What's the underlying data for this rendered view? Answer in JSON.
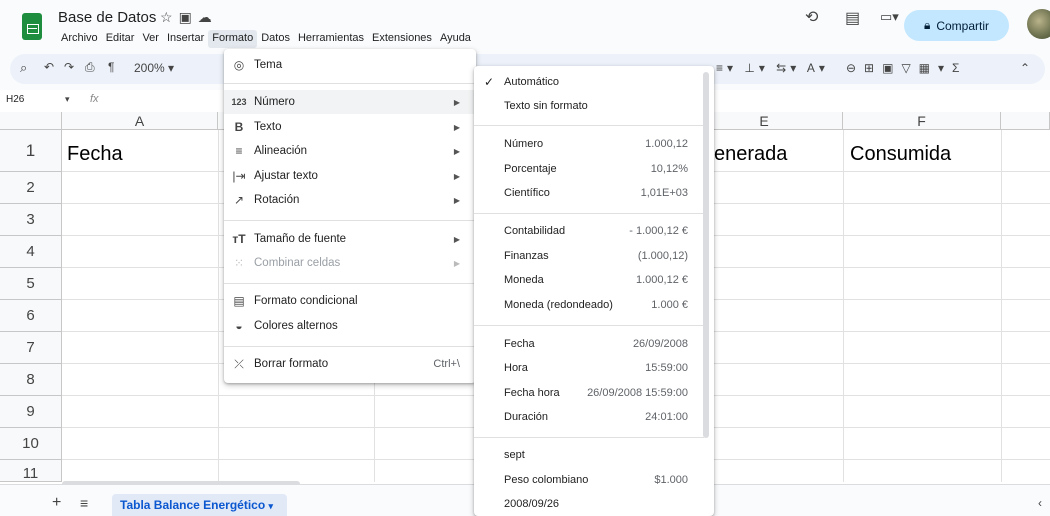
{
  "header": {
    "doc_title": "Base de Datos",
    "share_label": "Compartir"
  },
  "menubar": [
    "Archivo",
    "Editar",
    "Ver",
    "Insertar",
    "Formato",
    "Datos",
    "Herramientas",
    "Extensiones",
    "Ayuda"
  ],
  "toolbar": {
    "zoom": "200%"
  },
  "formula_bar": {
    "cell_ref": "H26",
    "fx": "fx"
  },
  "grid": {
    "columns": [
      "A",
      "E",
      "F"
    ],
    "rows": [
      "1",
      "2",
      "3",
      "4",
      "5",
      "6",
      "7",
      "8",
      "9",
      "10",
      "11"
    ],
    "cells": {
      "a1": "Fecha",
      "e1": "enerada",
      "f1": "Consumida"
    }
  },
  "sheets": {
    "active_tab": "Tabla Balance Energético"
  },
  "formato_menu": {
    "items": [
      {
        "icon": "palette-icon",
        "label": "Tema"
      },
      {
        "icon": "number-icon",
        "label": "Número",
        "glyph": "123"
      },
      {
        "icon": "bold-icon",
        "label": "Texto"
      },
      {
        "icon": "align-icon",
        "label": "Alineación"
      },
      {
        "icon": "wrap-icon",
        "label": "Ajustar texto"
      },
      {
        "icon": "rotate-icon",
        "label": "Rotación"
      },
      {
        "icon": "font-size-icon",
        "label": "Tamaño de fuente"
      },
      {
        "icon": "merge-icon",
        "label": "Combinar celdas"
      },
      {
        "icon": "conditional-icon",
        "label": "Formato condicional"
      },
      {
        "icon": "alternate-colors-icon",
        "label": "Colores alternos"
      },
      {
        "icon": "clear-format-icon",
        "label": "Borrar formato",
        "shortcut": "Ctrl+\\"
      }
    ]
  },
  "numero_menu": {
    "automatico": "Automático",
    "texto_sin_formato": "Texto sin formato",
    "numero": {
      "label": "Número",
      "value": "1.000,12"
    },
    "porcentaje": {
      "label": "Porcentaje",
      "value": "10,12%"
    },
    "cientifico": {
      "label": "Científico",
      "value": "1,01E+03"
    },
    "contabilidad": {
      "label": "Contabilidad",
      "value": "- 1.000,12 €"
    },
    "finanzas": {
      "label": "Finanzas",
      "value": "(1.000,12)"
    },
    "moneda": {
      "label": "Moneda",
      "value": "1.000,12 €"
    },
    "moneda_red": {
      "label": "Moneda (redondeado)",
      "value": "1.000 €"
    },
    "fecha": {
      "label": "Fecha",
      "value": "26/09/2008"
    },
    "hora": {
      "label": "Hora",
      "value": "15:59:00"
    },
    "fecha_hora": {
      "label": "Fecha hora",
      "value": "26/09/2008 15:59:00"
    },
    "duracion": {
      "label": "Duración",
      "value": "24:01:00"
    },
    "sept": "sept",
    "peso": {
      "label": "Peso colombiano",
      "value": "$1.000"
    },
    "fecha2": "2008/09/26"
  }
}
